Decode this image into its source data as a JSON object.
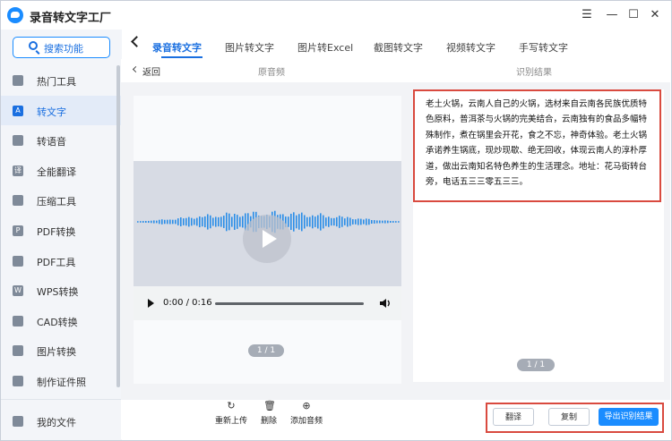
{
  "app": {
    "title": "录音转文字工厂"
  },
  "window": {
    "menu_glyph": "☰",
    "minimize_glyph": "—",
    "maximize_glyph": "☐",
    "close_glyph": "✕"
  },
  "sidebar": {
    "search_label": "搜索功能",
    "items": [
      {
        "label": "热门工具",
        "icon": "flame-icon",
        "glyph": ""
      },
      {
        "label": "转文字",
        "icon": "text-convert-icon",
        "glyph": "A"
      },
      {
        "label": "转语音",
        "icon": "voice-icon",
        "glyph": ""
      },
      {
        "label": "全能翻译",
        "icon": "translate-icon",
        "glyph": "译"
      },
      {
        "label": "压缩工具",
        "icon": "compress-icon",
        "glyph": ""
      },
      {
        "label": "PDF转换",
        "icon": "pdf-convert-icon",
        "glyph": "P"
      },
      {
        "label": "PDF工具",
        "icon": "pdf-tools-icon",
        "glyph": ""
      },
      {
        "label": "WPS转换",
        "icon": "wps-icon",
        "glyph": "W"
      },
      {
        "label": "CAD转换",
        "icon": "cad-icon",
        "glyph": ""
      },
      {
        "label": "图片转换",
        "icon": "image-convert-icon",
        "glyph": ""
      },
      {
        "label": "制作证件照",
        "icon": "id-photo-icon",
        "glyph": ""
      }
    ],
    "active_index": 1,
    "my_files": "我的文件"
  },
  "tabs": [
    {
      "label": "录音转文字",
      "active": true
    },
    {
      "label": "图片转文字"
    },
    {
      "label": "图片转Excel"
    },
    {
      "label": "截图转文字"
    },
    {
      "label": "视频转文字"
    },
    {
      "label": "手写转文字"
    }
  ],
  "subheader": {
    "back": "返回",
    "original_audio": "原音频",
    "result": "识别结果"
  },
  "player": {
    "time": "0:00 / 0:16",
    "progress": 0
  },
  "left_pager": "1 / 1",
  "right_pager": "1 / 1",
  "result_text": "老土火锅，云南人自己的火锅，选材来自云南各民族优质特色原料，普洱茶与火锅的完美结合，云南独有的食品多幅特殊制作，煮在锅里会开花，食之不忘，神奇体验。老土火锅承诺养生锅底，现炒现歇、绝无回收，体现云南人的淳朴厚道，做出云南知名特色养生的生活理念。地址：花马街转台旁，电话五三三零五三三。",
  "bottom_actions": [
    {
      "label": "重新上传",
      "icon": "reupload-icon",
      "glyph": "↻"
    },
    {
      "label": "删除",
      "icon": "trash-icon",
      "glyph": "🗑"
    },
    {
      "label": "添加音频",
      "icon": "add-audio-icon",
      "glyph": "⊕"
    }
  ],
  "buttons": {
    "translate": "翻译",
    "copy": "复制",
    "export": "导出识别结果"
  },
  "colors": {
    "accent": "#1a8cff",
    "highlight_border": "#d94a3f",
    "wave": "#2a8ee8"
  }
}
